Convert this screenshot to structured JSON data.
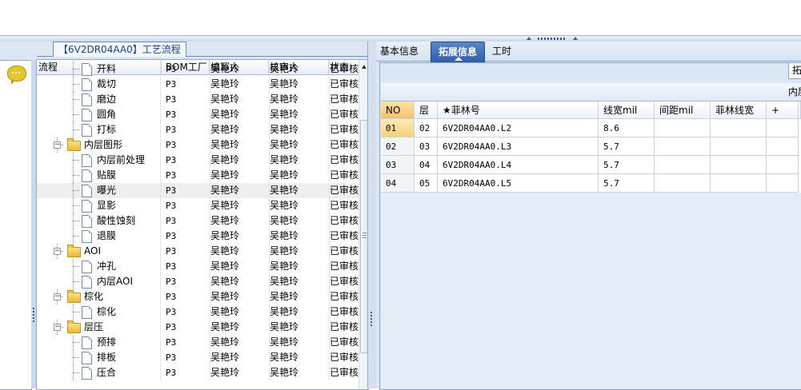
{
  "left_panel": {
    "group_caption": "【6V2DR04AA0】工艺流程",
    "columns": [
      "流程",
      "BOM工厂",
      "编写人",
      "核审人",
      "状态"
    ],
    "rows": [
      {
        "label": "开料",
        "level": 2,
        "kind": "doc",
        "bom": "P3",
        "editor": "吴艳玲",
        "reviewer": "吴艳玲",
        "status": "已审核"
      },
      {
        "label": "裁切",
        "level": 2,
        "kind": "doc",
        "bom": "P3",
        "editor": "吴艳玲",
        "reviewer": "吴艳玲",
        "status": "已审核"
      },
      {
        "label": "磨边",
        "level": 2,
        "kind": "doc",
        "bom": "P3",
        "editor": "吴艳玲",
        "reviewer": "吴艳玲",
        "status": "已审核"
      },
      {
        "label": "圆角",
        "level": 2,
        "kind": "doc",
        "bom": "P3",
        "editor": "吴艳玲",
        "reviewer": "吴艳玲",
        "status": "已审核"
      },
      {
        "label": "打标",
        "level": 2,
        "kind": "doc",
        "bom": "P3",
        "editor": "吴艳玲",
        "reviewer": "吴艳玲",
        "status": "已审核"
      },
      {
        "label": "内层图形",
        "level": 1,
        "kind": "folder",
        "bom": "P3",
        "editor": "吴艳玲",
        "reviewer": "吴艳玲",
        "status": "已审核"
      },
      {
        "label": "内层前处理",
        "level": 2,
        "kind": "doc",
        "bom": "P3",
        "editor": "吴艳玲",
        "reviewer": "吴艳玲",
        "status": "已审核"
      },
      {
        "label": "贴膜",
        "level": 2,
        "kind": "doc",
        "bom": "P3",
        "editor": "吴艳玲",
        "reviewer": "吴艳玲",
        "status": "已审核"
      },
      {
        "label": "曝光",
        "level": 2,
        "kind": "doc",
        "bom": "P3",
        "editor": "吴艳玲",
        "reviewer": "吴艳玲",
        "status": "已审核"
      },
      {
        "label": "显影",
        "level": 2,
        "kind": "doc",
        "bom": "P3",
        "editor": "吴艳玲",
        "reviewer": "吴艳玲",
        "status": "已审核"
      },
      {
        "label": "酸性蚀刻",
        "level": 2,
        "kind": "doc",
        "bom": "P3",
        "editor": "吴艳玲",
        "reviewer": "吴艳玲",
        "status": "已审核"
      },
      {
        "label": "退膜",
        "level": 2,
        "kind": "doc",
        "bom": "P3",
        "editor": "吴艳玲",
        "reviewer": "吴艳玲",
        "status": "已审核"
      },
      {
        "label": "AOI",
        "level": 1,
        "kind": "folder",
        "bom": "P3",
        "editor": "吴艳玲",
        "reviewer": "吴艳玲",
        "status": "已审核"
      },
      {
        "label": "冲孔",
        "level": 2,
        "kind": "doc",
        "bom": "P3",
        "editor": "吴艳玲",
        "reviewer": "吴艳玲",
        "status": "已审核"
      },
      {
        "label": "内层AOI",
        "level": 2,
        "kind": "doc",
        "bom": "P3",
        "editor": "吴艳玲",
        "reviewer": "吴艳玲",
        "status": "已审核"
      },
      {
        "label": "棕化",
        "level": 1,
        "kind": "folder",
        "bom": "P3",
        "editor": "吴艳玲",
        "reviewer": "吴艳玲",
        "status": "已审核"
      },
      {
        "label": "棕化",
        "level": 2,
        "kind": "doc",
        "bom": "P3",
        "editor": "吴艳玲",
        "reviewer": "吴艳玲",
        "status": "已审核"
      },
      {
        "label": "层压",
        "level": 1,
        "kind": "folder",
        "bom": "P3",
        "editor": "吴艳玲",
        "reviewer": "吴艳玲",
        "status": "已审核"
      },
      {
        "label": "预排",
        "level": 2,
        "kind": "doc",
        "bom": "P3",
        "editor": "吴艳玲",
        "reviewer": "吴艳玲",
        "status": "已审核"
      },
      {
        "label": "排板",
        "level": 2,
        "kind": "doc",
        "bom": "P3",
        "editor": "吴艳玲",
        "reviewer": "吴艳玲",
        "status": "已审核"
      },
      {
        "label": "压合",
        "level": 2,
        "kind": "doc",
        "bom": "P3",
        "editor": "吴艳玲",
        "reviewer": "吴艳玲",
        "status": "已审核"
      }
    ],
    "selected_row": 8
  },
  "right_panel": {
    "tabs": [
      "基本信息",
      "拓展信息",
      "工时"
    ],
    "active_tab": 1,
    "ext_button": "拓",
    "inner_header": "内层",
    "columns": [
      "NO",
      "层",
      "★菲林号",
      "线宽mil",
      "间距mil",
      "菲林线宽",
      "+"
    ],
    "rows": [
      {
        "no": "01",
        "layer": "02",
        "film": "6V2DR04AA0.L2",
        "width": "8.6",
        "spacing": "",
        "film_width": "",
        "plus": ""
      },
      {
        "no": "02",
        "layer": "03",
        "film": "6V2DR04AA0.L3",
        "width": "5.7",
        "spacing": "",
        "film_width": "",
        "plus": ""
      },
      {
        "no": "03",
        "layer": "04",
        "film": "6V2DR04AA0.L4",
        "width": "5.7",
        "spacing": "",
        "film_width": "",
        "plus": ""
      },
      {
        "no": "04",
        "layer": "05",
        "film": "6V2DR04AA0.L5",
        "width": "5.7",
        "spacing": "",
        "film_width": "",
        "plus": ""
      }
    ],
    "current_row": 0
  },
  "colors": {
    "panel_bg": "#dbe7f5",
    "active_tab": "#2f5fa9",
    "caption_text": "#15428b",
    "current_row_marker": "#f7c35f"
  }
}
